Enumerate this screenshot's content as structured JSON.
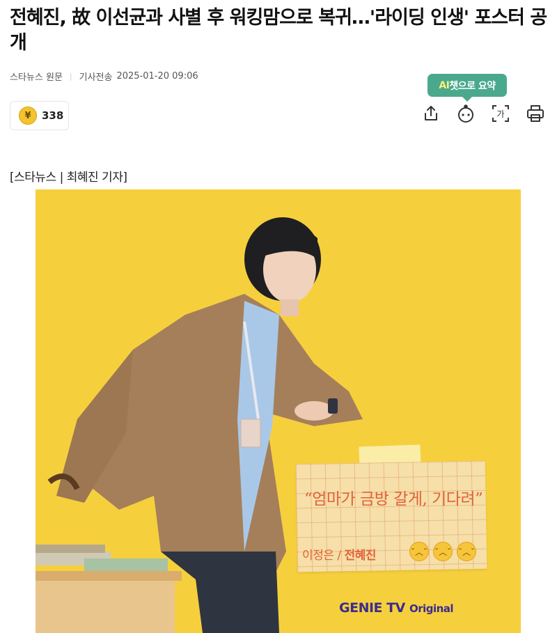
{
  "article": {
    "headline": "전혜진, 故 이선균과 사별 후 워킹맘으로 복귀…'라이딩 인생' 포스터 공개",
    "source": "스타뉴스",
    "original_link": "원문",
    "date_label": "기사전송",
    "date": "2025-01-20 09:06",
    "byline": "[스타뉴스 | 최혜진 기자]"
  },
  "reactions": {
    "coin_symbol": "¥",
    "count": "338"
  },
  "toolbar": {
    "ai_tooltip_prefix": "AI",
    "ai_tooltip_suffix": "챗으로 요약",
    "share_icon": "share-icon",
    "ai_bot_icon": "ai-bot-icon",
    "font_size_icon": "font-size-icon",
    "font_size_glyph": "가",
    "print_icon": "print-icon"
  },
  "poster": {
    "quote": "“엄마가 금방 갈게, 기다려”",
    "character": "이정은 /",
    "actor": "전혜진",
    "brand_main": "GENIE TV",
    "brand_sub": "Original",
    "background_color": "#f6cf3d"
  }
}
